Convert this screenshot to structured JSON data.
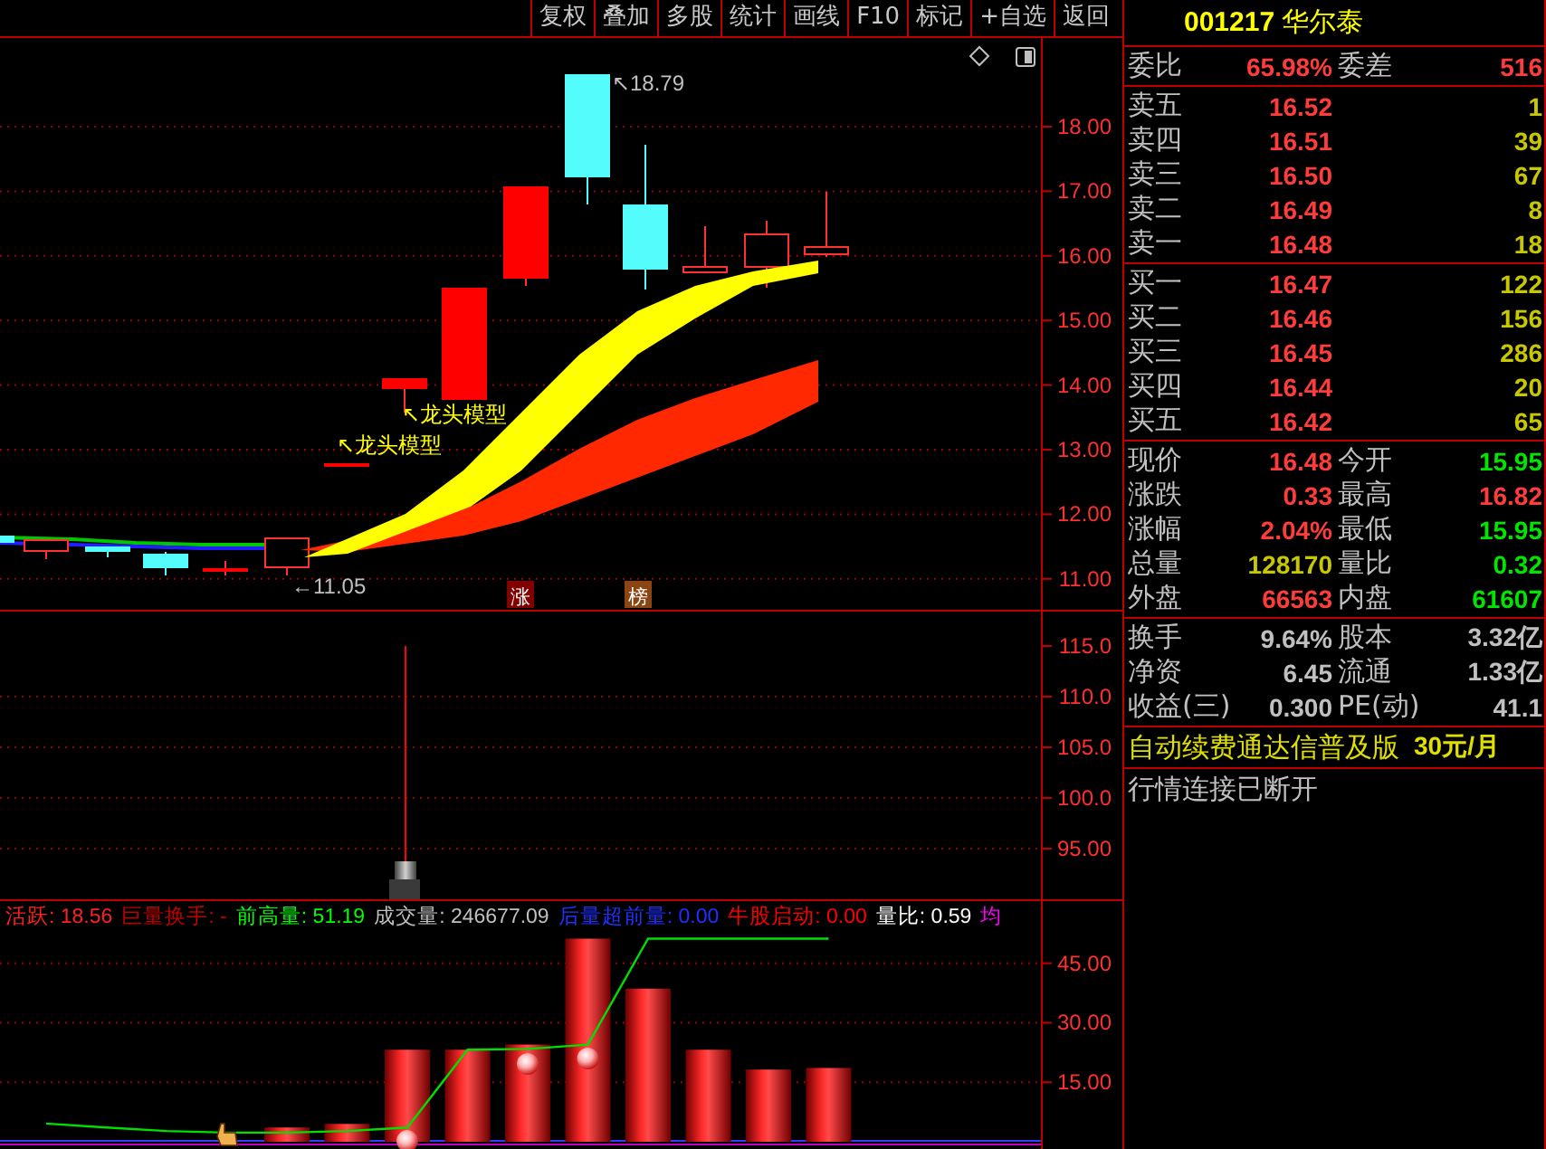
{
  "toolbar": {
    "buttons": [
      "复权",
      "叠加",
      "多股",
      "统计",
      "画线",
      "F10",
      "标记",
      "+自选",
      "返回"
    ]
  },
  "main_chart": {
    "y_axis_labels": [
      "18.00",
      "17.00",
      "16.00",
      "15.00",
      "14.00",
      "13.00",
      "12.00",
      "11.00"
    ],
    "annotations": [
      {
        "kind": "price",
        "text": "↖18.79"
      },
      {
        "kind": "price",
        "text": "←11.05"
      },
      {
        "kind": "signal",
        "text": "↖龙头模型"
      },
      {
        "kind": "signal",
        "text": "↖龙头模型"
      }
    ],
    "badges": [
      {
        "text": "涨",
        "color": "#800000"
      },
      {
        "text": "榜",
        "color": "#8b4513"
      }
    ]
  },
  "middle_chart": {
    "y_axis_labels": [
      "115.0",
      "110.0",
      "105.0",
      "100.0",
      "95.00"
    ]
  },
  "bottom_chart": {
    "indicators": [
      {
        "text": "活跃: 18.56",
        "color": "#ff2020"
      },
      {
        "text": "巨量换手: -",
        "color": "#c00000"
      },
      {
        "text": "前高量: 51.19",
        "color": "#00ff00"
      },
      {
        "text": "成交量: 246677.09",
        "color": "#c0c0c0"
      },
      {
        "text": "后量超前量: 0.00",
        "color": "#2030ff"
      },
      {
        "text": "牛股启动: 0.00",
        "color": "#ff0000"
      },
      {
        "text": "量比: 0.59",
        "color": "#ffffff"
      },
      {
        "text": "均",
        "color": "#ff00ff"
      }
    ],
    "chart_data": {
      "type": "bar",
      "grid": true,
      "series": [
        {
          "values": [
            null,
            null,
            null,
            null,
            3.6,
            4.5,
            23.2,
            23.2,
            24.5,
            51.2,
            38.6,
            23.2,
            18.2,
            18.6
          ]
        },
        {
          "type": "line",
          "color": "#00e000",
          "values": [
            4.6,
            3.6,
            2.7,
            2.3,
            2.3,
            2.7,
            3.6,
            23.2,
            23.4,
            24.5,
            51.2,
            51.2,
            51.2,
            51.2
          ]
        },
        {
          "type": "scatter",
          "values": [
            null,
            null,
            null,
            null,
            null,
            null,
            0.2,
            null,
            19.6,
            21,
            null,
            null,
            null,
            null
          ]
        }
      ],
      "ylim": [
        0,
        52
      ],
      "yticks": [
        {
          "value": 15,
          "label": "15.00"
        },
        {
          "value": 30,
          "label": "30.00"
        },
        {
          "value": 45,
          "label": "45.00"
        }
      ]
    }
  },
  "quote_panel": {
    "code": "001217",
    "name": "华尔泰",
    "commission": [
      {
        "label": "委比",
        "value": "65.98%"
      },
      {
        "label": "委差",
        "value": "516"
      }
    ],
    "sell": [
      {
        "label": "卖五",
        "price": "16.52",
        "volume": "1"
      },
      {
        "label": "卖四",
        "price": "16.51",
        "volume": "39"
      },
      {
        "label": "卖三",
        "price": "16.50",
        "volume": "67"
      },
      {
        "label": "卖二",
        "price": "16.49",
        "volume": "8"
      },
      {
        "label": "卖一",
        "price": "16.48",
        "volume": "18"
      }
    ],
    "buy": [
      {
        "label": "买一",
        "price": "16.47",
        "volume": "122"
      },
      {
        "label": "买二",
        "price": "16.46",
        "volume": "156"
      },
      {
        "label": "买三",
        "price": "16.45",
        "volume": "286"
      },
      {
        "label": "买四",
        "price": "16.44",
        "volume": "20"
      },
      {
        "label": "买五",
        "price": "16.42",
        "volume": "65"
      }
    ],
    "quote": [
      {
        "label": "现价",
        "value": "16.48",
        "color": "#ff3c3c"
      },
      {
        "label": "今开",
        "value": "15.95",
        "color": "#00e600"
      },
      {
        "label": "涨跌",
        "value": "0.33",
        "color": "#ff3c3c"
      },
      {
        "label": "最高",
        "value": "16.82",
        "color": "#ff3c3c"
      },
      {
        "label": "涨幅",
        "value": "2.04%",
        "color": "#ff3c3c"
      },
      {
        "label": "最低",
        "value": "15.95",
        "color": "#00e600"
      },
      {
        "label": "总量",
        "value": "128170",
        "color": "#c8c800"
      },
      {
        "label": "量比",
        "value": "0.32",
        "color": "#00e600"
      },
      {
        "label": "外盘",
        "value": "66563",
        "color": "#ff3c3c"
      },
      {
        "label": "内盘",
        "value": "61607",
        "color": "#00e600"
      }
    ],
    "info": [
      {
        "label": "换手",
        "value": "9.64%"
      },
      {
        "label": "股本",
        "value": "3.32亿"
      },
      {
        "label": "净资",
        "value": "6.45"
      },
      {
        "label": "流通",
        "value": "1.33亿"
      },
      {
        "label": "收益(三)",
        "value": "0.300"
      },
      {
        "label": "PE(动)",
        "value": "41.1"
      }
    ],
    "promo": {
      "text": "自动续费通达信普及版",
      "price": "30元/月"
    },
    "status": "行情连接已断开"
  }
}
